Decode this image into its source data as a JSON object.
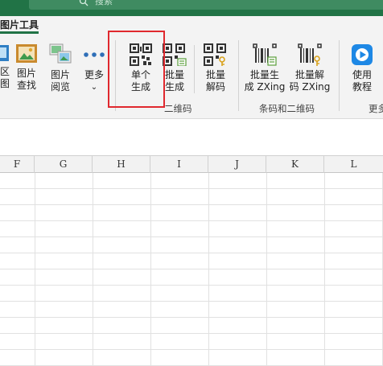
{
  "search": {
    "placeholder": "搜索"
  },
  "tab": {
    "label": "图片工具"
  },
  "ribbon": {
    "buttons_left": [
      {
        "name": "partial-button",
        "label1": "区",
        "label2": "图"
      },
      {
        "name": "image-search-button",
        "label1": "图片",
        "label2": "查找"
      },
      {
        "name": "image-browse-button",
        "label1": "图片",
        "label2": "阅览"
      },
      {
        "name": "more-button",
        "label1": "更多",
        "label2": "⌄"
      }
    ],
    "qr_group": {
      "single_generate": {
        "label1": "单个",
        "label2": "生成"
      },
      "batch_generate": {
        "label1": "批量",
        "label2": "生成"
      },
      "batch_decode": {
        "label1": "批量",
        "label2": "解码"
      },
      "group_label": "二维码"
    },
    "barcode_group": {
      "batch_generate_zxing": {
        "label1": "批量生",
        "label2": "成 ZXing"
      },
      "batch_decode_zxing": {
        "label1": "批量解",
        "label2": "码 ZXing"
      },
      "group_label": "条码和二维码"
    },
    "tutorial": {
      "label1": "使用",
      "label2": "教程",
      "group_label": "更多"
    }
  },
  "columns": [
    "F",
    "G",
    "H",
    "I",
    "J",
    "K",
    "L"
  ],
  "colors": {
    "accent": "#217346",
    "highlight": "#e0282e",
    "play": "#1e88e5"
  },
  "icons": {
    "search": "search-icon",
    "qr": "qr-code-icon",
    "barcode": "barcode-icon",
    "play": "play-icon",
    "image": "image-icon"
  }
}
